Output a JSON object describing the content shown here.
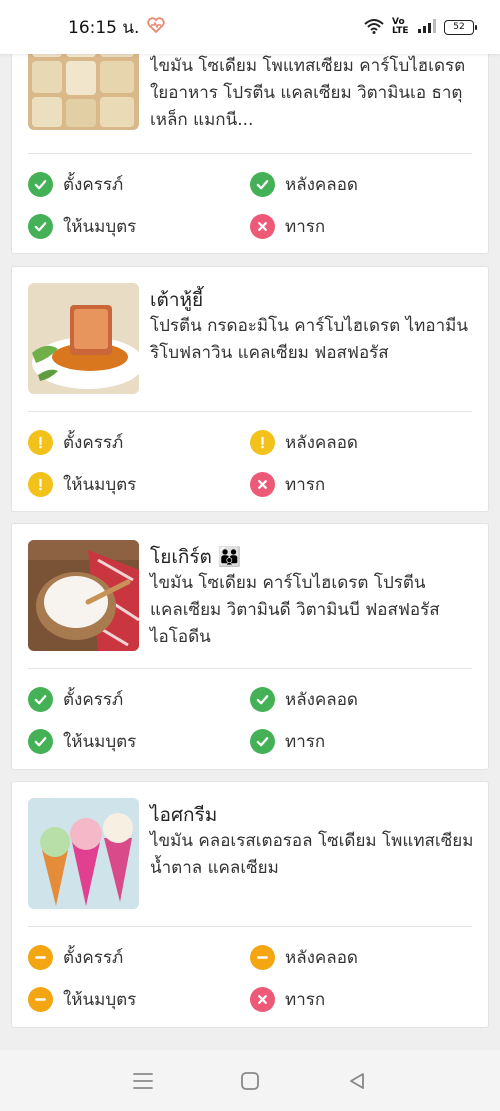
{
  "status_bar": {
    "time": "16:15 น.",
    "heart_icon": "heart-rate-icon",
    "network": "Vo LTE",
    "battery": "52"
  },
  "tag_labels": {
    "pregnant": "ตั้งครรภ์",
    "postpartum": "หลังคลอด",
    "breastfeeding": "ให้นมบุตร",
    "infant": "ทารก"
  },
  "colors": {
    "ok": "#45b156",
    "no": "#ec5a78",
    "warn": "#f3c21a",
    "moderate": "#f3a611"
  },
  "foods": [
    {
      "title": "",
      "nutrients": "ไขมัน โซเดียม โพแทสเซียม คาร์โบไฮเดรต ใยอาหาร โปรตีน แคลเซียม วิตามินเอ ธาตุเหล็ก แมกนี...",
      "statuses": {
        "pregnant": "ok",
        "postpartum": "ok",
        "breastfeeding": "ok",
        "infant": "no"
      }
    },
    {
      "title": "เต้าหู้ยี้",
      "nutrients": "โปรตีน กรดอะมิโน คาร์โบไฮเดรต ไทอามีน ริโบฟลาวิน แคลเซียม ฟอสฟอรัส",
      "statuses": {
        "pregnant": "warn",
        "postpartum": "warn",
        "breastfeeding": "warn",
        "infant": "no"
      }
    },
    {
      "title": "โยเกิร์ต 👪",
      "nutrients": "ไขมัน โซเดียม คาร์โบไฮเดรต โปรตีน แคลเซียม วิตามินดี วิตามินบี ฟอสฟอรัส ไอโอดีน",
      "statuses": {
        "pregnant": "ok",
        "postpartum": "ok",
        "breastfeeding": "ok",
        "infant": "ok"
      }
    },
    {
      "title": "ไอศกรีม",
      "nutrients": "ไขมัน คลอเรสเตอรอล โซเดียม โพแทสเซียม น้ำตาล แคลเซียม",
      "statuses": {
        "pregnant": "moderate",
        "postpartum": "moderate",
        "breastfeeding": "moderate",
        "infant": "no"
      }
    }
  ],
  "nav": {
    "menu_icon": "recent-apps-icon",
    "home_icon": "home-icon",
    "back_icon": "back-icon"
  }
}
